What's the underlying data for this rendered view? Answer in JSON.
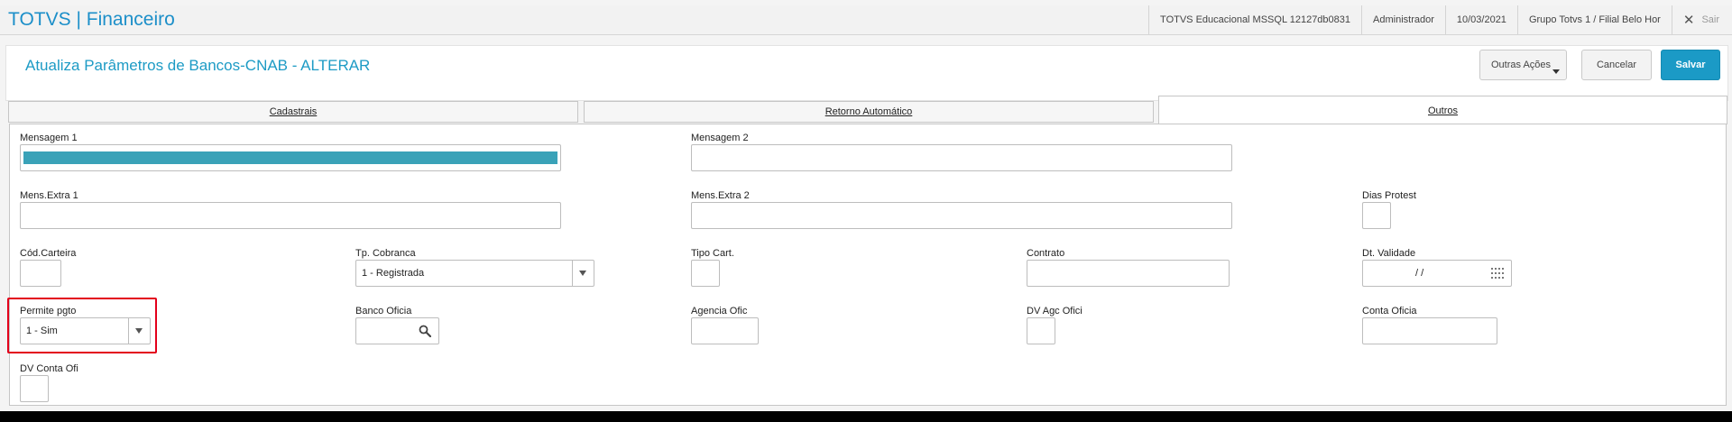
{
  "app": {
    "brand": "TOTVS | Financeiro"
  },
  "topbar": {
    "environment": "TOTVS Educacional MSSQL 12127db0831",
    "user": "Administrador",
    "date": "10/03/2021",
    "branch": "Grupo Totvs 1 / Filial Belo Hor",
    "exit_label": "Sair",
    "exit_icon": "close-icon"
  },
  "header": {
    "title": "Atualiza Parâmetros de Bancos-CNAB - ALTERAR",
    "more_actions": "Outras Ações",
    "cancel": "Cancelar",
    "save": "Salvar"
  },
  "tabs": [
    {
      "label": "Cadastrais",
      "active": false
    },
    {
      "label": "Retorno Automático",
      "active": false
    },
    {
      "label": "Outros",
      "active": true
    }
  ],
  "form": {
    "mensagem1": {
      "label": "Mensagem 1",
      "value": ""
    },
    "mensagem2": {
      "label": "Mensagem 2",
      "value": ""
    },
    "mens_extra1": {
      "label": "Mens.Extra 1",
      "value": ""
    },
    "mens_extra2": {
      "label": "Mens.Extra 2",
      "value": ""
    },
    "dias_protest": {
      "label": "Dias Protest",
      "value": ""
    },
    "cod_carteira": {
      "label": "Cód.Carteira",
      "value": ""
    },
    "tp_cobranca": {
      "label": "Tp. Cobranca",
      "value": "1 - Registrada"
    },
    "tipo_cart": {
      "label": "Tipo Cart.",
      "value": ""
    },
    "contrato": {
      "label": "Contrato",
      "value": ""
    },
    "dt_validade": {
      "label": "Dt. Validade",
      "value": "/ /"
    },
    "permite_pgto": {
      "label": "Permite pgto",
      "value": "1 - Sim"
    },
    "banco_oficia": {
      "label": "Banco Oficia",
      "value": ""
    },
    "agencia_ofic": {
      "label": "Agencia Ofic",
      "value": ""
    },
    "dv_agc_ofici": {
      "label": "DV Agc Ofici",
      "value": ""
    },
    "conta_oficia": {
      "label": "Conta Oficia",
      "value": ""
    },
    "dv_conta_ofi": {
      "label": "DV Conta Ofi",
      "value": ""
    }
  },
  "colors": {
    "accent": "#1b9ac6",
    "highlight": "#e3001b",
    "selection_fill": "#3aa2b8"
  }
}
